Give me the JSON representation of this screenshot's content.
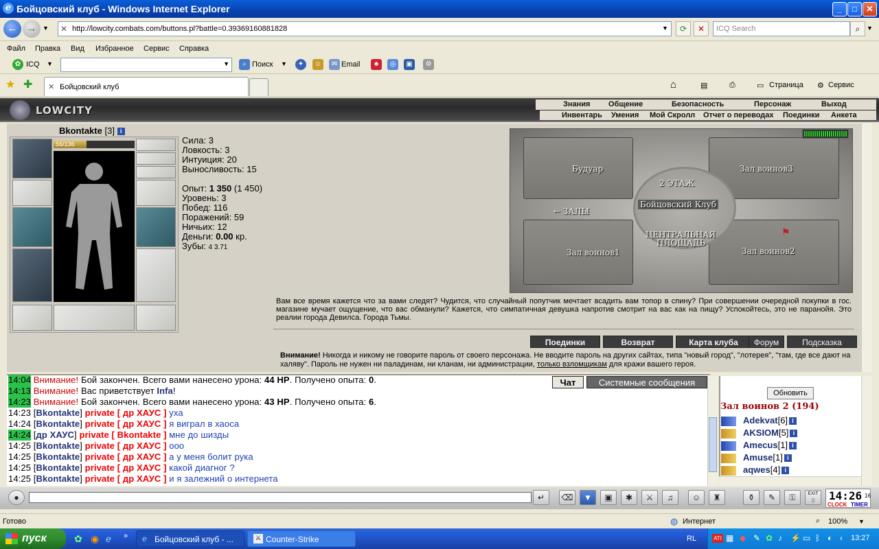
{
  "window": {
    "title": "Бойцовский клуб - Windows Internet Explorer",
    "min": "_",
    "max": "□",
    "close": "✕"
  },
  "address": {
    "url": "http://lowcity.combats.com/buttons.pl?battle=0.39369160881828",
    "search_placeholder": "ICQ Search"
  },
  "menu": [
    "Файл",
    "Правка",
    "Вид",
    "Избранное",
    "Сервис",
    "Справка"
  ],
  "toolbar": {
    "icq_label": "ICQ",
    "search_label": "Поиск",
    "email_label": "Email"
  },
  "tabs": {
    "active_tab": "Бойцовский клуб",
    "page_label": "Страница",
    "tools_label": "Сервис"
  },
  "game": {
    "logo": "LOWCITY",
    "nav_top": [
      "Знания",
      "Общение",
      "Безопасность",
      "Персонаж",
      "Выход"
    ],
    "nav_bottom": [
      "Инвентарь",
      "Умения",
      "Мой Скролл",
      "Отчет о переводах",
      "Поединки",
      "Анкета"
    ]
  },
  "character": {
    "name": "Bkontakte",
    "level_tag": "[3]",
    "hp_text": "56/136",
    "hp_fraction": 0.41,
    "stats": [
      {
        "label": "Сила:",
        "value": "3"
      },
      {
        "label": "Ловкость:",
        "value": "3"
      },
      {
        "label": "Интуиция:",
        "value": "20"
      },
      {
        "label": "Выносливость:",
        "value": "15"
      }
    ],
    "exp_label": "Опыт:",
    "exp_value": "1 350",
    "exp_next": "(1 450)",
    "level_label": "Уровень:",
    "level_value": "3",
    "wins_label": "Побед:",
    "wins_value": "116",
    "losses_label": "Поражений:",
    "losses_value": "59",
    "draws_label": "Ничьих:",
    "draws_value": "12",
    "money_label": "Деньги:",
    "money_value": "0.00",
    "money_unit": "кр.",
    "teeth_label": "Зубы:",
    "teeth_value": "4 3.71"
  },
  "map": {
    "labels": {
      "boudoir": "Будуар",
      "hall3": "Зал воинов3",
      "floor2": "2 ЭТАЖ",
      "club": "Бойцовский Клуб",
      "halls": "← ЗАЛЫ",
      "central1": "ЦЕНТРАЛЬНАЯ",
      "central2": "ПЛОЩАДЬ",
      "hall1": "Зал воинов1",
      "hall2": "Зал воинов2"
    }
  },
  "description": "Вам все время кажется что за вами следят? Чудится, что случайный попутчик мечтает всадить вам топор в спину? При совершении очередной покупки в гос. магазине мучает ощущение, что вас обманули? Кажется, что симпатичная девушка напротив смотрит на вас как на пищу? Успокойтесь, это не паранойя. Это реалии города Девилса. Города Тьмы.",
  "actions": [
    "Поединки",
    "Возврат",
    "Карта клуба",
    "Форум",
    "Подсказка"
  ],
  "warning": {
    "title": "Внимание!",
    "text": "Никогда и никому не говорите пароль от своего персонажа. Не вводите пароль на других сайтах, типа \"новый город\", \"лотерея\", \"там, где все дают на халяву\". Пароль не нужен ни паладинам, ни кланам, ни администрации,",
    "link": "только взломщикам",
    "tail": "для кражи вашего героя."
  },
  "chat": {
    "tabs": [
      "Чат",
      "Системные сообщения"
    ],
    "messages": [
      {
        "time": "14:04",
        "hl": true,
        "p1": "Внимание!",
        "p2": " Бой закончен. Всего вами нанесено урона: ",
        "b1": "44 HP",
        "p3": ". Получено опыта: ",
        "b2": "0",
        "p4": "."
      },
      {
        "time": "14:13",
        "hl": true,
        "p1": "Внимание!",
        "p2": " Вас приветствует ",
        "b1": "Infa",
        "p3": "!"
      },
      {
        "time": "14:23",
        "hl": true,
        "p1": "Внимание!",
        "p2": " Бой закончен. Всего вами нанесено урона: ",
        "b1": "43 HP",
        "p3": ". Получено опыта: ",
        "b2": "6",
        "p4": "."
      },
      {
        "time": "14:23",
        "from": "Bkontakte",
        "to": "др ХАУС",
        "text": "уха"
      },
      {
        "time": "14:24",
        "from": "Bkontakte",
        "to": "др ХАУС",
        "text": "я виграл в хаоса"
      },
      {
        "time": "14:24",
        "hl": true,
        "from": "др ХАУС",
        "to": "Bkontakte",
        "text": "мне до шизды"
      },
      {
        "time": "14:25",
        "from": "Bkontakte",
        "to": "др ХАУС",
        "text": "ооо"
      },
      {
        "time": "14:25",
        "from": "Bkontakte",
        "to": "др ХАУС",
        "text": "а у меня болит рука"
      },
      {
        "time": "14:25",
        "from": "Bkontakte",
        "to": "др ХАУС",
        "text": "какой диагног ?"
      },
      {
        "time": "14:25",
        "from": "Bkontakte",
        "to": "др ХАУС",
        "text": "и я залежний о интернета"
      }
    ],
    "private_prefix": "private [ ",
    "private_suffix": " ]"
  },
  "users": {
    "refresh": "Обновить",
    "room": "Зал воинов 2 (194)",
    "list": [
      {
        "name": "Adekvat",
        "lvl": "[6]"
      },
      {
        "name": "AKSIOM",
        "lvl": "[5]"
      },
      {
        "name": "Amecus",
        "lvl": "[1]"
      },
      {
        "name": "Amuse",
        "lvl": "[1]"
      },
      {
        "name": "aqwes",
        "lvl": "[4]"
      }
    ]
  },
  "clock": {
    "time": "14:26",
    "sec": "16",
    "clock_label": "CLOCK",
    "timer_label": "TIMER",
    "exit": "EXIT"
  },
  "status": {
    "text": "Готово",
    "zone": "Интернет",
    "zoom": "100%"
  },
  "taskbar": {
    "start": "пуск",
    "tasks": [
      "Бойцовский клуб - ...",
      "Counter-Strike"
    ],
    "lang": "RL",
    "time": "13:27"
  }
}
